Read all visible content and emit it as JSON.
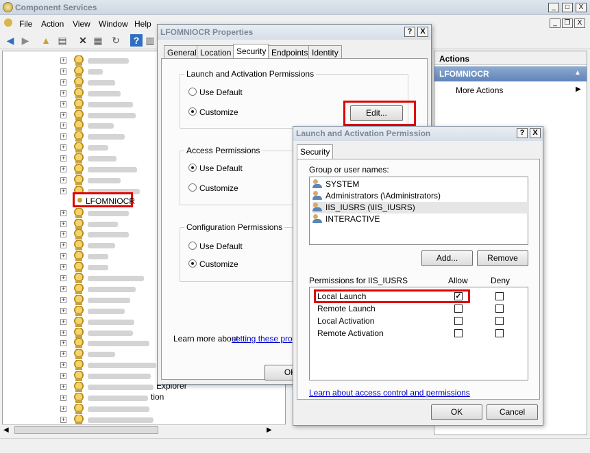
{
  "window": {
    "title": "Component Services",
    "controls": {
      "minimize": "_",
      "restore": "□",
      "close": "X"
    }
  },
  "menu": {
    "items": [
      "File",
      "Action",
      "View",
      "Window",
      "Help"
    ],
    "mdi_controls": {
      "minimize": "_",
      "restore": "❐",
      "close": "X"
    }
  },
  "tree": {
    "selected_item": "LFOMNIOCR",
    "visible_fragments": [
      "Explorer",
      "tion"
    ]
  },
  "actions": {
    "header": "Actions",
    "selected": "LFOMNIOCR",
    "more_actions": "More Actions"
  },
  "props_dialog": {
    "title": "LFOMNIOCR Properties",
    "help_btn": "?",
    "close_btn": "X",
    "tabs": [
      "General",
      "Location",
      "Security",
      "Endpoints",
      "Identity"
    ],
    "active_tab": "Security",
    "launch_group": {
      "title": "Launch and Activation Permissions",
      "use_default": "Use Default",
      "customize": "Customize",
      "selected": "customize"
    },
    "edit_button": "Edit...",
    "access_group": {
      "title": "Access Permissions",
      "use_default": "Use Default",
      "customize": "Customize",
      "selected": "use_default"
    },
    "config_group": {
      "title": "Configuration Permissions",
      "use_default": "Use Default",
      "customize": "Customize",
      "selected": "customize"
    },
    "learn_more": "Learn more about",
    "learn_link": "setting these prope",
    "ok_button": "OK"
  },
  "perm_dialog": {
    "title": "Launch and Activation Permission",
    "help_btn": "?",
    "close_btn": "X",
    "tab": "Security",
    "group_label": "Group or user names:",
    "users": [
      {
        "name": "SYSTEM",
        "selected": false
      },
      {
        "name": "Administrators (\\Administrators)",
        "selected": false
      },
      {
        "name": "IIS_IUSRS (\\IIS_IUSRS)",
        "selected": true
      },
      {
        "name": "INTERACTIVE",
        "selected": false
      }
    ],
    "add_button": "Add...",
    "remove_button": "Remove",
    "permissions_label": "Permissions for IIS_IUSRS",
    "allow_header": "Allow",
    "deny_header": "Deny",
    "permissions": [
      {
        "name": "Local Launch",
        "allow": true,
        "deny": false
      },
      {
        "name": "Remote Launch",
        "allow": false,
        "deny": false
      },
      {
        "name": "Local Activation",
        "allow": false,
        "deny": false
      },
      {
        "name": "Remote Activation",
        "allow": false,
        "deny": false
      }
    ],
    "learn_link": "Learn about access control and permissions",
    "ok_button": "OK",
    "cancel_button": "Cancel"
  },
  "colors": {
    "highlight_red": "#e00000",
    "selection_blue": "#5f84b8",
    "link": "#0000cc"
  }
}
